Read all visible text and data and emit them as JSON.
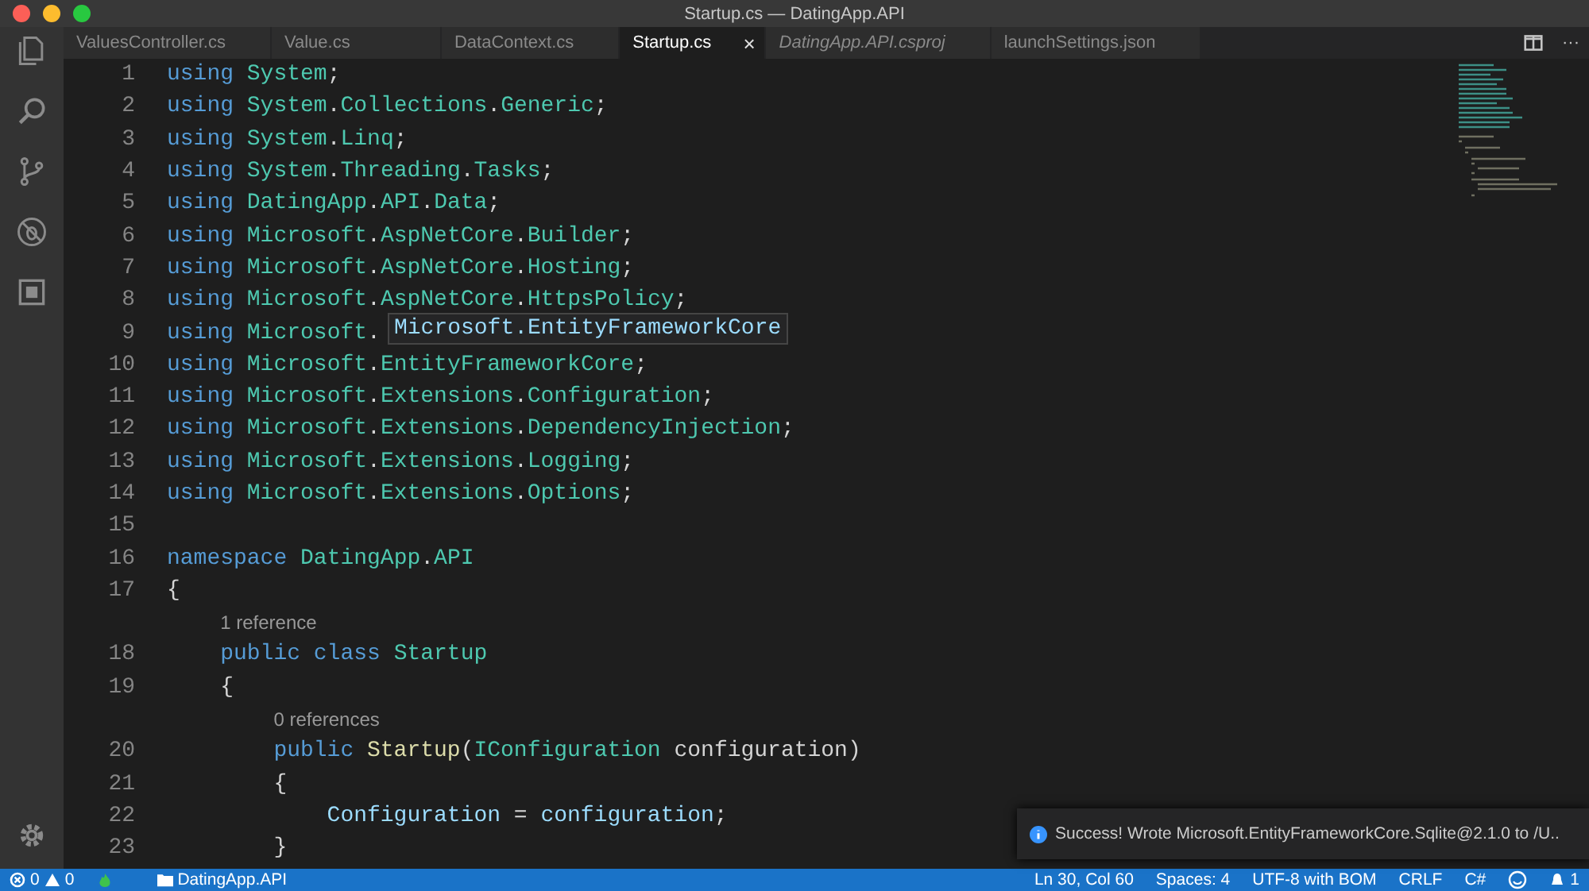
{
  "window": {
    "title": "Startup.cs — DatingApp.API"
  },
  "tabs": [
    {
      "label": "ValuesController.cs",
      "selected": false,
      "preview": false
    },
    {
      "label": "Value.cs",
      "selected": false,
      "preview": false
    },
    {
      "label": "DataContext.cs",
      "selected": false,
      "preview": false
    },
    {
      "label": "Startup.cs",
      "selected": true,
      "preview": false,
      "close": "×"
    },
    {
      "label": "DatingApp.API.csproj",
      "selected": false,
      "preview": true
    },
    {
      "label": "launchSettings.json",
      "selected": false,
      "preview": false
    }
  ],
  "tab_actions": {
    "more": "···"
  },
  "editor": {
    "lines": [
      {
        "kind": "code",
        "number": "1",
        "tokens": [
          {
            "kind": "keyword",
            "text": "using"
          },
          {
            "kind": "name",
            "text": "System"
          },
          {
            "kind": "plain",
            "text": ";"
          }
        ]
      },
      {
        "kind": "code",
        "number": "2",
        "tokens": [
          {
            "kind": "keyword",
            "text": "using"
          },
          {
            "kind": "name",
            "text": "System"
          },
          {
            "kind": "plain",
            "text": "."
          },
          {
            "kind": "name",
            "text": "Collections"
          },
          {
            "kind": "plain",
            "text": "."
          },
          {
            "kind": "name",
            "text": "Generic"
          },
          {
            "kind": "plain",
            "text": ";"
          }
        ]
      },
      {
        "kind": "code",
        "number": "3",
        "tokens": [
          {
            "kind": "keyword",
            "text": "using"
          },
          {
            "kind": "name",
            "text": "System"
          },
          {
            "kind": "plain",
            "text": "."
          },
          {
            "kind": "name",
            "text": "Linq"
          },
          {
            "kind": "plain",
            "text": ";"
          }
        ]
      },
      {
        "kind": "code",
        "number": "4",
        "tokens": [
          {
            "kind": "keyword",
            "text": "using"
          },
          {
            "kind": "name",
            "text": "System"
          },
          {
            "kind": "plain",
            "text": "."
          },
          {
            "kind": "name",
            "text": "Threading"
          },
          {
            "kind": "plain",
            "text": "."
          },
          {
            "kind": "name",
            "text": "Tasks"
          },
          {
            "kind": "plain",
            "text": ";"
          }
        ]
      },
      {
        "kind": "code",
        "number": "5",
        "tokens": [
          {
            "kind": "keyword",
            "text": "using"
          },
          {
            "kind": "name",
            "text": "DatingApp"
          },
          {
            "kind": "plain",
            "text": "."
          },
          {
            "kind": "name",
            "text": "API"
          },
          {
            "kind": "plain",
            "text": "."
          },
          {
            "kind": "name",
            "text": "Data"
          },
          {
            "kind": "plain",
            "text": ";"
          }
        ]
      },
      {
        "kind": "code",
        "number": "6",
        "tokens": [
          {
            "kind": "keyword",
            "text": "using"
          },
          {
            "kind": "name",
            "text": "Microsoft"
          },
          {
            "kind": "plain",
            "text": "."
          },
          {
            "kind": "name",
            "text": "AspNetCore"
          },
          {
            "kind": "plain",
            "text": "."
          },
          {
            "kind": "name",
            "text": "Builder"
          },
          {
            "kind": "plain",
            "text": ";"
          }
        ]
      },
      {
        "kind": "code",
        "number": "7",
        "tokens": [
          {
            "kind": "keyword",
            "text": "using"
          },
          {
            "kind": "name",
            "text": "Microsoft"
          },
          {
            "kind": "plain",
            "text": "."
          },
          {
            "kind": "name",
            "text": "AspNetCore"
          },
          {
            "kind": "plain",
            "text": "."
          },
          {
            "kind": "name",
            "text": "Hosting"
          },
          {
            "kind": "plain",
            "text": ";"
          }
        ]
      },
      {
        "kind": "code",
        "number": "8",
        "tokens": [
          {
            "kind": "keyword",
            "text": "using"
          },
          {
            "kind": "name",
            "text": "Microsoft"
          },
          {
            "kind": "plain",
            "text": "."
          },
          {
            "kind": "name",
            "text": "AspNetCore"
          },
          {
            "kind": "plain",
            "text": "."
          },
          {
            "kind": "name",
            "text": "HttpsPolicy"
          },
          {
            "kind": "plain",
            "text": ";"
          }
        ]
      },
      {
        "kind": "code",
        "number": "9",
        "tokens": [
          {
            "kind": "keyword",
            "text": "using"
          },
          {
            "kind": "name",
            "text": "Microsoft"
          },
          {
            "kind": "plain",
            "text": "."
          }
        ]
      },
      {
        "kind": "code",
        "number": "10",
        "tokens": [
          {
            "kind": "keyword",
            "text": "using"
          },
          {
            "kind": "name",
            "text": "Microsoft"
          },
          {
            "kind": "plain",
            "text": "."
          },
          {
            "kind": "name",
            "text": "EntityFrameworkCore"
          },
          {
            "kind": "plain",
            "text": ";"
          }
        ]
      },
      {
        "kind": "code",
        "number": "11",
        "tokens": [
          {
            "kind": "keyword",
            "text": "using"
          },
          {
            "kind": "name",
            "text": "Microsoft"
          },
          {
            "kind": "plain",
            "text": "."
          },
          {
            "kind": "name",
            "text": "Extensions"
          },
          {
            "kind": "plain",
            "text": "."
          },
          {
            "kind": "name",
            "text": "Configuration"
          },
          {
            "kind": "plain",
            "text": ";"
          }
        ]
      },
      {
        "kind": "code",
        "number": "12",
        "tokens": [
          {
            "kind": "keyword",
            "text": "using"
          },
          {
            "kind": "name",
            "text": "Microsoft"
          },
          {
            "kind": "plain",
            "text": "."
          },
          {
            "kind": "name",
            "text": "Extensions"
          },
          {
            "kind": "plain",
            "text": "."
          },
          {
            "kind": "name",
            "text": "DependencyInjection"
          },
          {
            "kind": "plain",
            "text": ";"
          }
        ]
      },
      {
        "kind": "code",
        "number": "13",
        "tokens": [
          {
            "kind": "keyword",
            "text": "using"
          },
          {
            "kind": "name",
            "text": "Microsoft"
          },
          {
            "kind": "plain",
            "text": "."
          },
          {
            "kind": "name",
            "text": "Extensions"
          },
          {
            "kind": "plain",
            "text": "."
          },
          {
            "kind": "name",
            "text": "Logging"
          },
          {
            "kind": "plain",
            "text": ";"
          }
        ]
      },
      {
        "kind": "code",
        "number": "14",
        "tokens": [
          {
            "kind": "keyword",
            "text": "using"
          },
          {
            "kind": "name",
            "text": "Microsoft"
          },
          {
            "kind": "plain",
            "text": "."
          },
          {
            "kind": "name",
            "text": "Extensions"
          },
          {
            "kind": "plain",
            "text": "."
          },
          {
            "kind": "name",
            "text": "Options"
          },
          {
            "kind": "plain",
            "text": ";"
          }
        ]
      },
      {
        "kind": "code",
        "number": "15"
      },
      {
        "kind": "code",
        "number": "16",
        "tokens": [
          {
            "kind": "keyword",
            "text": "namespace"
          },
          {
            "kind": "name",
            "text": "DatingApp"
          },
          {
            "kind": "plain",
            "text": "."
          },
          {
            "kind": "name",
            "text": "API"
          }
        ]
      },
      {
        "kind": "code",
        "number": "17",
        "tokens": [
          {
            "kind": "plain",
            "text": "{"
          }
        ],
        "children": [
          {
            "kind": "lens",
            "text": "1 reference"
          },
          {
            "kind": "code",
            "number": "18",
            "tokens": [
              {
                "kind": "keyword",
                "text": "public"
              },
              {
                "kind": "keyword",
                "text": "class"
              },
              {
                "kind": "name",
                "text": "Startup"
              }
            ]
          },
          {
            "kind": "code",
            "number": "19",
            "tokens": [
              {
                "kind": "plain",
                "text": "{"
              }
            ],
            "children": [
              {
                "kind": "lens",
                "text": "0 references"
              },
              {
                "kind": "code",
                "number": "20",
                "tokens": [
                  {
                    "kind": "keyword",
                    "text": "public"
                  },
                  {
                    "kind": "method",
                    "text": "Startup"
                  },
                  {
                    "kind": "plain",
                    "text": "("
                  },
                  {
                    "kind": "name",
                    "text": "IConfiguration"
                  },
                  {
                    "kind": "plain",
                    "text": "configuration)"
                  }
                ]
              },
              {
                "kind": "code",
                "number": "21",
                "tokens": [
                  {
                    "kind": "plain",
                    "text": "{"
                  }
                ],
                "children": [
                  {
                    "kind": "code",
                    "number": "22",
                    "tokens": [
                      {
                        "kind": "variable",
                        "text": "Configuration"
                      },
                      {
                        "kind": "plain",
                        "text": "="
                      },
                      {
                        "kind": "variable",
                        "text": "configuration"
                      },
                      {
                        "kind": "plain",
                        "text": ";"
                      }
                    ]
                  }
                ]
              },
              {
                "kind": "code",
                "number": "23",
                "tokens": [
                  {
                    "kind": "plain",
                    "text": "}"
                  }
                ]
              }
            ]
          }
        ]
      }
    ],
    "hover": {
      "text": "Microsoft.EntityFrameworkCore"
    }
  },
  "notification": {
    "message": "Success! Wrote Microsoft.EntityFrameworkCore.Sqlite@2.1.0 to /U.."
  },
  "status_bar": {
    "errors": "0",
    "warnings": "0",
    "folder": "DatingApp.API",
    "position": "Ln 30, Col 60",
    "indentation": "Spaces: 4",
    "encoding": "UTF-8 with BOM",
    "line_ending": "CRLF",
    "language": "C#",
    "notifications": "1"
  }
}
